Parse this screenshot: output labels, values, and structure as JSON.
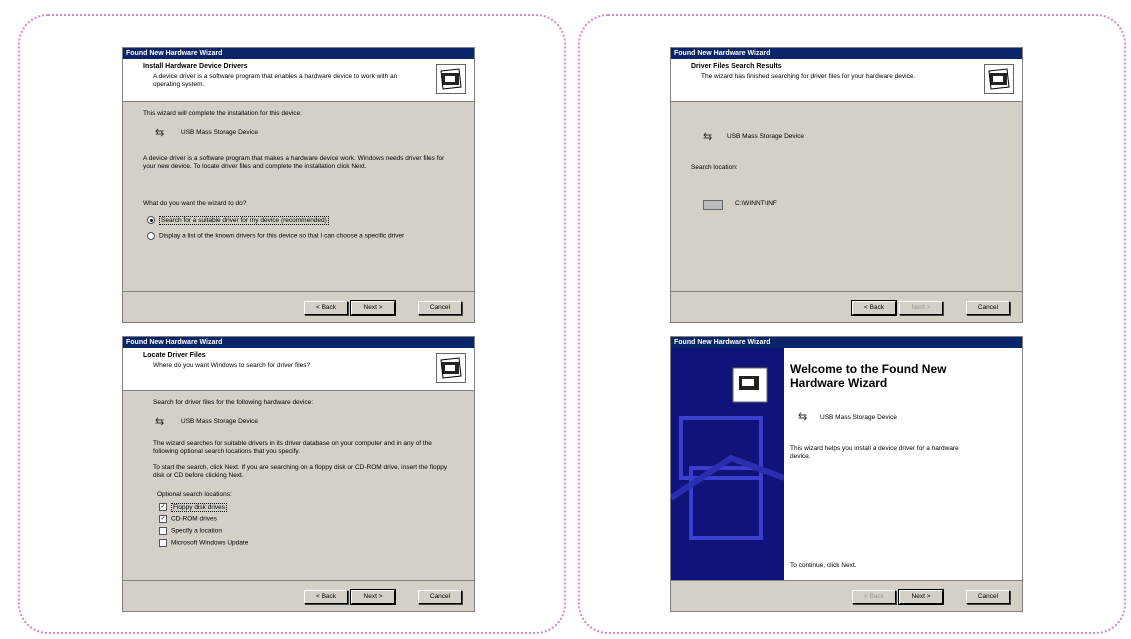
{
  "wizard_title": "Found New Hardware Wizard",
  "device_name": "USB Mass Storage Device",
  "buttons": {
    "back": "< Back",
    "next": "Next >",
    "cancel": "Cancel"
  },
  "install_drivers": {
    "header_title": "Install Hardware Device Drivers",
    "header_subtitle": "A device driver is a software program that enables a hardware device to work with an operating system.",
    "intro": "This wizard will complete the installation for this device:",
    "body": "A device driver is a software program that makes a hardware device work. Windows needs driver files for your new device. To locate driver files and complete the installation click Next.",
    "question": "What do you want the wizard to do?",
    "option_search": "Search for a suitable driver for my device (recommended)",
    "option_display": "Display a list of the known drivers for this device so that I can choose a specific driver"
  },
  "search_results": {
    "header_title": "Driver Files Search Results",
    "header_subtitle": "The wizard has finished searching for driver files for your hardware device.",
    "search_location_label": "Search location:",
    "location_path": "C:\\WINNT\\INF"
  },
  "locate_files": {
    "header_title": "Locate Driver Files",
    "header_subtitle": "Where do you want Windows to search for driver files?",
    "intro": "Search for driver files for the following hardware device:",
    "body1": "The wizard searches for suitable drivers in its driver database on your computer and in any of the following optional search locations that you specify.",
    "body2": "To start the search, click Next. If you are searching on a floppy disk or CD-ROM drive, insert the floppy disk or CD before clicking Next.",
    "optional_label": "Optional search locations:",
    "options": [
      {
        "label": "Floppy disk drives",
        "checked": true
      },
      {
        "label": "CD-ROM drives",
        "checked": true
      },
      {
        "label": "Specify a location",
        "checked": false
      },
      {
        "label": "Microsoft Windows Update",
        "checked": false
      }
    ]
  },
  "welcome": {
    "title": "Welcome to the Found New Hardware Wizard",
    "body": "This wizard helps you install a device driver for a hardware device.",
    "continue_text": "To continue, click Next."
  },
  "colors": {
    "titlebar": "#0a246a",
    "dialog_bg": "#d4d0c8",
    "panel_border": "#d98cc4",
    "side_image": "#10137a"
  },
  "icons": [
    "wizard-hardware-icon",
    "usb-icon",
    "drive-icon"
  ]
}
